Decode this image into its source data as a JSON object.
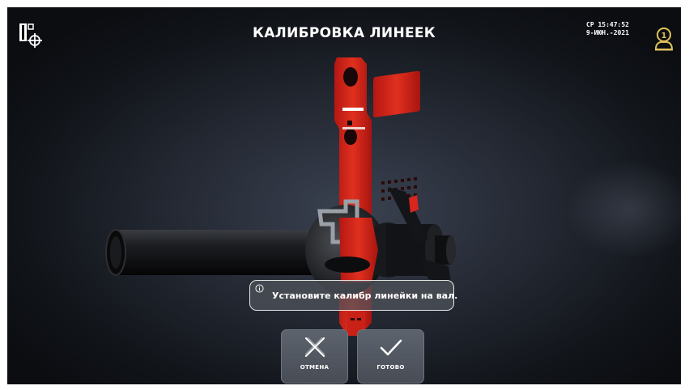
{
  "header": {
    "title": "КАЛИБРОВКА ЛИНЕЕК",
    "clock_line1": "СР 15:47:52",
    "clock_line2": "9-ИЮН.-2021",
    "user_badge": "1"
  },
  "icons": {
    "app_logo": "ruler-crosshair-icon",
    "user": "operator-user-icon",
    "info": "info-icon",
    "cancel": "cross-icon",
    "done": "checkmark-icon"
  },
  "message": {
    "text": "Установите калибр линейки на вал."
  },
  "buttons": {
    "cancel_label": "ОТМЕНА",
    "done_label": "ГОТОВО"
  },
  "colors": {
    "accent_red": "#d8261f",
    "user_icon": "#e0c25a",
    "text": "#ffffff"
  }
}
